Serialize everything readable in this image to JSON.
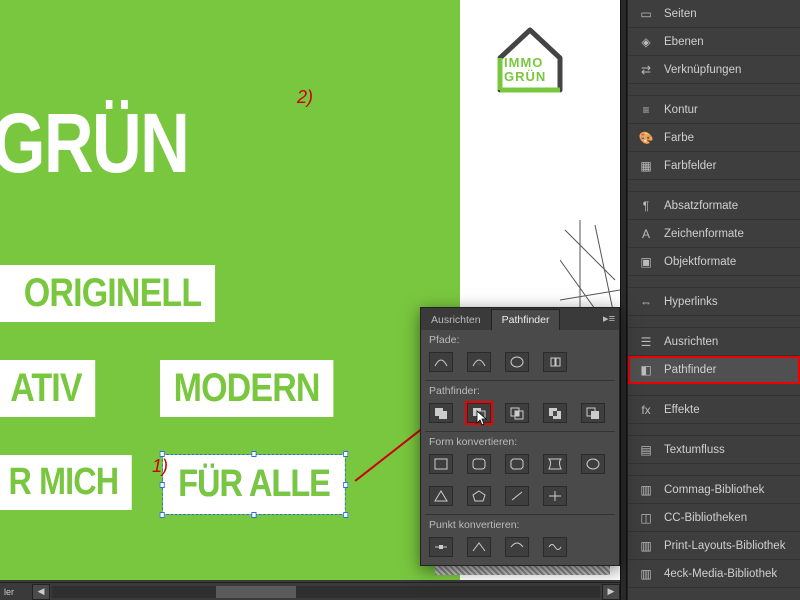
{
  "canvas": {
    "logo": {
      "line1": "IMMO",
      "line2": "GRÜN"
    },
    "headline": "OGRÜN",
    "tags": {
      "originell": "ORIGINELL",
      "ativ": "ATIV",
      "modern": "MODERN",
      "rmich": "R MICH",
      "furalle": "FÜR ALLE"
    },
    "annotations": {
      "a1": "1)",
      "a2": "2)"
    }
  },
  "rail": {
    "items": [
      {
        "icon": "pages-icon",
        "label": "Seiten"
      },
      {
        "icon": "layers-icon",
        "label": "Ebenen"
      },
      {
        "icon": "links-icon",
        "label": "Verknüpfungen"
      }
    ],
    "group2": [
      {
        "icon": "stroke-icon",
        "label": "Kontur"
      },
      {
        "icon": "color-icon",
        "label": "Farbe"
      },
      {
        "icon": "swatches-icon",
        "label": "Farbfelder"
      }
    ],
    "group3": [
      {
        "icon": "para-style-icon",
        "label": "Absatzformate"
      },
      {
        "icon": "char-style-icon",
        "label": "Zeichenformate"
      },
      {
        "icon": "obj-style-icon",
        "label": "Objektformate"
      }
    ],
    "group4": [
      {
        "icon": "hyperlinks-icon",
        "label": "Hyperlinks"
      }
    ],
    "group5": [
      {
        "icon": "align-icon",
        "label": "Ausrichten"
      },
      {
        "icon": "pathfinder-icon",
        "label": "Pathfinder",
        "highlight": true
      }
    ],
    "group6": [
      {
        "icon": "effects-icon",
        "label": "Effekte"
      }
    ],
    "group7": [
      {
        "icon": "textwrap-icon",
        "label": "Textumfluss"
      }
    ],
    "group8": [
      {
        "icon": "lib-icon",
        "label": "Commag-Bibliothek"
      },
      {
        "icon": "cc-lib-icon",
        "label": "CC-Bibliotheken"
      },
      {
        "icon": "lib-icon",
        "label": "Print-Layouts-Bibliothek"
      },
      {
        "icon": "lib-icon",
        "label": "4eck-Media-Bibliothek"
      }
    ]
  },
  "panel": {
    "tabs": {
      "align": "Ausrichten",
      "pathfinder": "Pathfinder"
    },
    "sections": {
      "pfade": "Pfade:",
      "pathfinder": "Pathfinder:",
      "form": "Form konvertieren:",
      "punkt": "Punkt konvertieren:"
    }
  },
  "colors": {
    "green": "#79c73f",
    "red": "#e00000",
    "panel_bg": "#4a4a4a"
  }
}
